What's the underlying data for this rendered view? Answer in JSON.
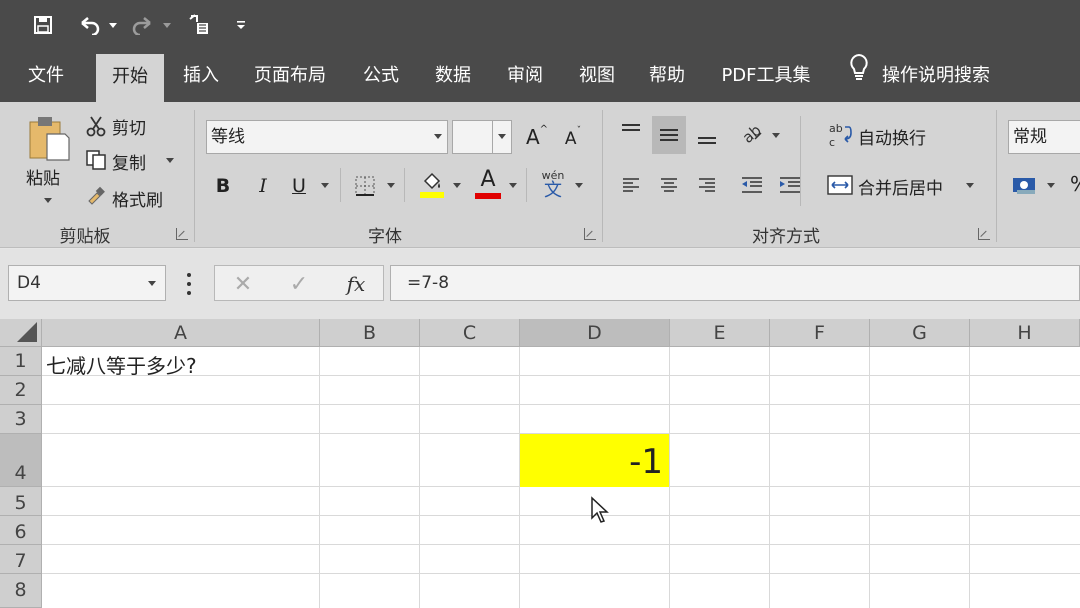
{
  "quick_access": {
    "save_icon": "save-icon",
    "undo_icon": "undo-icon",
    "redo_icon": "redo-icon",
    "touch_icon": "touch-mode-icon",
    "customize_icon": "customize-qat-icon"
  },
  "tabs": [
    {
      "label": "文件"
    },
    {
      "label": "开始"
    },
    {
      "label": "插入"
    },
    {
      "label": "页面布局"
    },
    {
      "label": "公式"
    },
    {
      "label": "数据"
    },
    {
      "label": "审阅"
    },
    {
      "label": "视图"
    },
    {
      "label": "帮助"
    },
    {
      "label": "PDF工具集"
    }
  ],
  "tell_me": {
    "label": "操作说明搜索",
    "icon": "lightbulb-icon"
  },
  "ribbon": {
    "clipboard": {
      "paste_label": "粘贴",
      "cut_label": "剪切",
      "copy_label": "复制",
      "format_painter_label": "格式刷",
      "group_label": "剪贴板"
    },
    "font": {
      "font_name": "等线",
      "font_size": "",
      "bold": "B",
      "italic": "I",
      "underline": "U",
      "grow": "A",
      "shrink": "A",
      "phonetic": "wén",
      "phonetic_char": "文",
      "font_color": "A",
      "highlight_color": "#ffff00",
      "text_color": "#ff0000",
      "group_label": "字体"
    },
    "alignment": {
      "wrap_label": "自动换行",
      "merge_label": "合并后居中",
      "group_label": "对齐方式"
    },
    "number": {
      "format": "常规"
    }
  },
  "formula_bar": {
    "name_box": "D4",
    "cancel_symbol": "✕",
    "enter_symbol": "✓",
    "fx_symbol": "fx",
    "formula": "=7-8"
  },
  "grid": {
    "columns": [
      "A",
      "B",
      "C",
      "D",
      "E",
      "F",
      "G",
      "H"
    ],
    "rows": [
      "1",
      "2",
      "3",
      "4",
      "5",
      "6",
      "7",
      "8"
    ],
    "cells": {
      "A1": "七减八等于多少?",
      "D4": "-1"
    },
    "selected_cell_fill": "#ffff00"
  }
}
